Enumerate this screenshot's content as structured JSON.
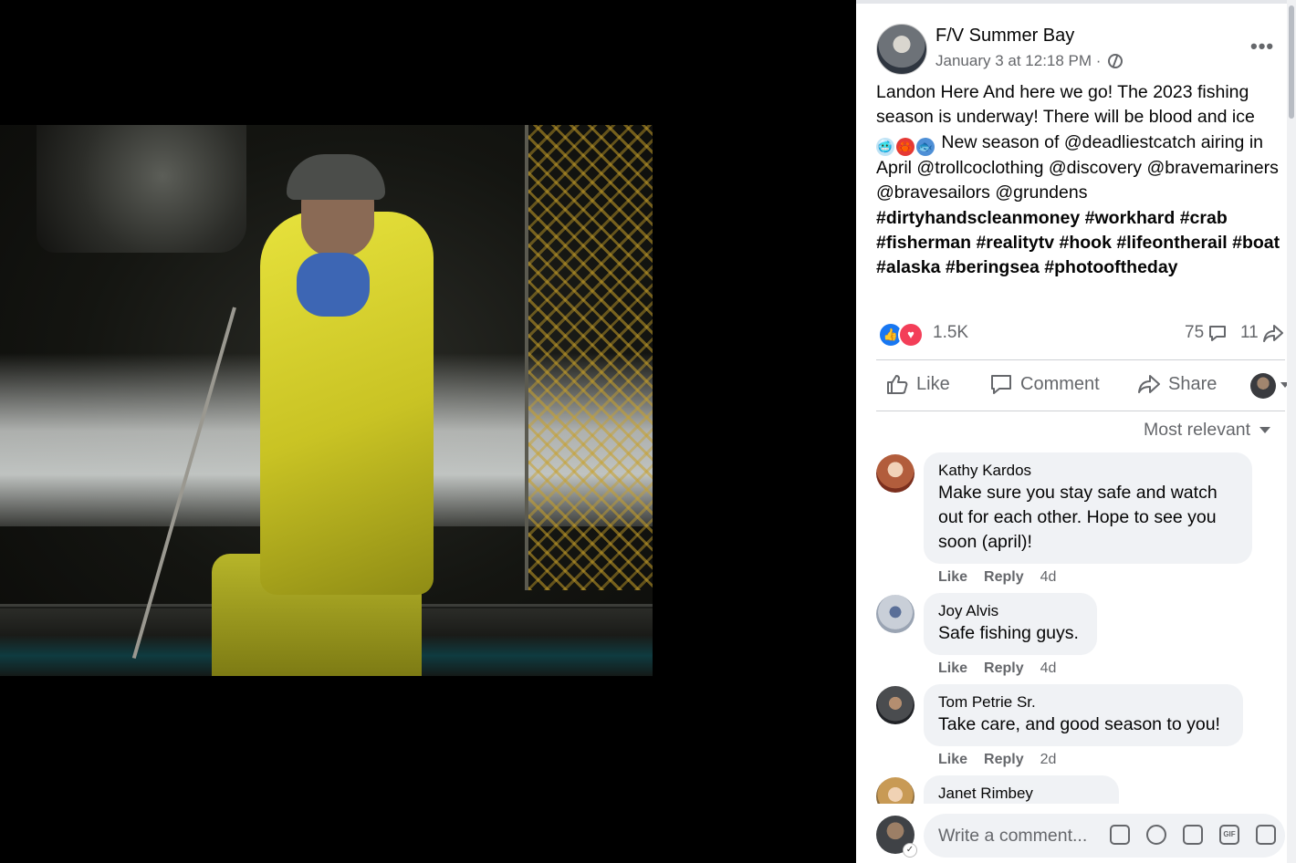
{
  "post": {
    "author": "F/V Summer Bay",
    "timestamp": "January 3 at 12:18 PM ·",
    "text_intro": "Landon Here And here we go! The 2023 fishing season is underway! There will be blood and ice",
    "emoji_1": "🥶",
    "emoji_2": "🦀",
    "emoji_3": "🐟",
    "text_mentions": "New season of @deadliestcatch airing in April @trollcoclothing @discovery @bravemariners @bravesailors @grundens",
    "hashtags": "#dirtyhandscleanmoney #workhard #crab #fisherman #realitytv #hook #lifeontherail #boat #alaska #beringsea #photooftheday",
    "reaction_count": "1.5K",
    "comment_count": "75",
    "share_count": "11",
    "more_label": "•••"
  },
  "actions": {
    "like": "Like",
    "comment": "Comment",
    "share": "Share"
  },
  "sort_label": "Most relevant",
  "comments": [
    {
      "author": "Kathy Kardos",
      "text": "Make sure you stay safe and watch out for each other. Hope to see you soon (april)!",
      "like": "Like",
      "reply": "Reply",
      "age": "4d"
    },
    {
      "author": "Joy Alvis",
      "text": "Safe fishing guys.",
      "like": "Like",
      "reply": "Reply",
      "age": "4d"
    },
    {
      "author": "Tom Petrie Sr.",
      "text": "Take care, and good season to you!",
      "like": "Like",
      "reply": "Reply",
      "age": "2d"
    },
    {
      "author": "Janet Rimbey",
      "text": "",
      "like": "",
      "reply": "",
      "age": ""
    }
  ],
  "composer": {
    "placeholder": "Write a comment...",
    "gif_label": "GIF"
  },
  "colors": {
    "accent": "#1877f2",
    "love": "#f33e58",
    "muted_text": "#65676b",
    "bubble": "#f0f2f5",
    "jacket": "#e7e23c"
  },
  "icons": [
    "globe-icon",
    "more-icon",
    "like-reaction-icon",
    "love-reaction-icon",
    "comment-icon",
    "share-icon",
    "thumb-icon",
    "sticker-icon",
    "emoji-icon",
    "camera-icon",
    "gif-icon"
  ]
}
